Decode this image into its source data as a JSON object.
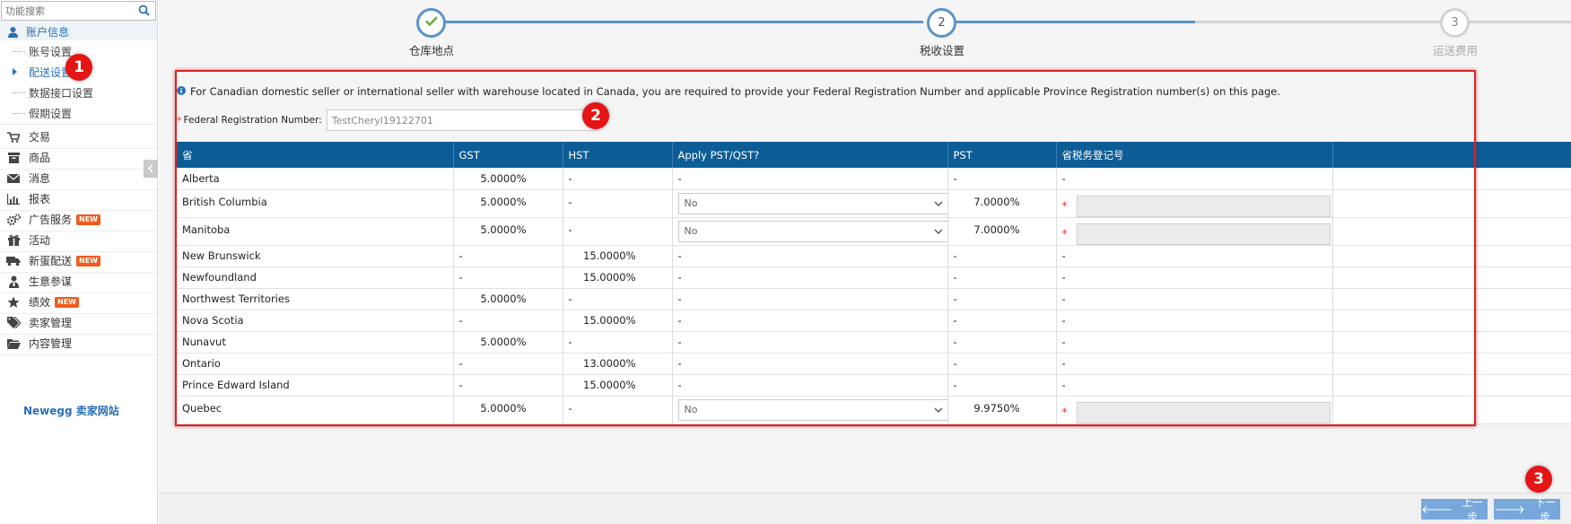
{
  "sidebar": {
    "search_placeholder": "功能搜索",
    "account_header": "账户信息",
    "sub_items": [
      {
        "label": "账号设置"
      },
      {
        "label": "配送设置"
      },
      {
        "label": "数据接口设置"
      },
      {
        "label": "假期设置"
      }
    ],
    "menu": [
      {
        "label": "交易",
        "icon": "cart-icon"
      },
      {
        "label": "商品",
        "icon": "box-icon"
      },
      {
        "label": "消息",
        "icon": "mail-icon"
      },
      {
        "label": "报表",
        "icon": "bar-chart-icon"
      },
      {
        "label": "广告服务",
        "icon": "gears-icon",
        "badge": "NEW"
      },
      {
        "label": "活动",
        "icon": "gift-icon"
      },
      {
        "label": "新蛋配送",
        "icon": "truck-icon",
        "badge": "NEW"
      },
      {
        "label": "生意参谋",
        "icon": "advisor-icon"
      },
      {
        "label": "绩效",
        "icon": "star-icon",
        "badge": "NEW"
      },
      {
        "label": "卖家管理",
        "icon": "tags-icon"
      },
      {
        "label": "内容管理",
        "icon": "folder-icon"
      }
    ],
    "site_link": "Newegg 卖家网站"
  },
  "stepper": {
    "steps": [
      {
        "number": "✓",
        "label": "仓库地点",
        "state": "done"
      },
      {
        "number": "2",
        "label": "税收设置",
        "state": "current"
      },
      {
        "number": "3",
        "label": "运送费用",
        "state": "pending"
      }
    ]
  },
  "notice": "For Canadian domestic seller or international seller with warehouse located in Canada, you are required to provide your Federal Registration Number and applicable Province Registration number(s) on this page.",
  "federal": {
    "required_mark": "*",
    "label": "Federal Registration Number:",
    "value": "TestCheryl19122701"
  },
  "table": {
    "headers": [
      "省",
      "GST",
      "HST",
      "Apply PST/QST?",
      "PST",
      "省税务登记号"
    ],
    "rows": [
      {
        "province": "Alberta",
        "gst": "5.0000%",
        "hst": "-",
        "apply": "-",
        "pst": "-",
        "reg": "-"
      },
      {
        "province": "British Columbia",
        "gst": "5.0000%",
        "hst": "-",
        "apply_select": "No",
        "pst": "7.0000%",
        "reg_input": true
      },
      {
        "province": "Manitoba",
        "gst": "5.0000%",
        "hst": "-",
        "apply_select": "No",
        "pst": "7.0000%",
        "reg_input": true
      },
      {
        "province": "New Brunswick",
        "gst": "-",
        "hst": "15.0000%",
        "apply": "-",
        "pst": "-",
        "reg": "-"
      },
      {
        "province": "Newfoundland",
        "gst": "-",
        "hst": "15.0000%",
        "apply": "-",
        "pst": "-",
        "reg": "-"
      },
      {
        "province": "Northwest Territories",
        "gst": "5.0000%",
        "hst": "-",
        "apply": "-",
        "pst": "-",
        "reg": "-"
      },
      {
        "province": "Nova Scotia",
        "gst": "-",
        "hst": "15.0000%",
        "apply": "-",
        "pst": "-",
        "reg": "-"
      },
      {
        "province": "Nunavut",
        "gst": "5.0000%",
        "hst": "-",
        "apply": "-",
        "pst": "-",
        "reg": "-"
      },
      {
        "province": "Ontario",
        "gst": "-",
        "hst": "13.0000%",
        "apply": "-",
        "pst": "-",
        "reg": "-"
      },
      {
        "province": "Prince Edward Island",
        "gst": "-",
        "hst": "15.0000%",
        "apply": "-",
        "pst": "-",
        "reg": "-"
      },
      {
        "province": "Quebec",
        "gst": "5.0000%",
        "hst": "-",
        "apply_select": "No",
        "pst": "9.9750%",
        "reg_input": true
      }
    ]
  },
  "footer": {
    "prev_label": "上一步",
    "next_label": "下一步"
  },
  "annotations": [
    "1",
    "2",
    "3"
  ],
  "colors": {
    "accent": "#2b70b7",
    "table_header": "#0c5d96",
    "button": "#78a8db",
    "annotation": "#e02222",
    "new_badge": "#f05b1b"
  }
}
